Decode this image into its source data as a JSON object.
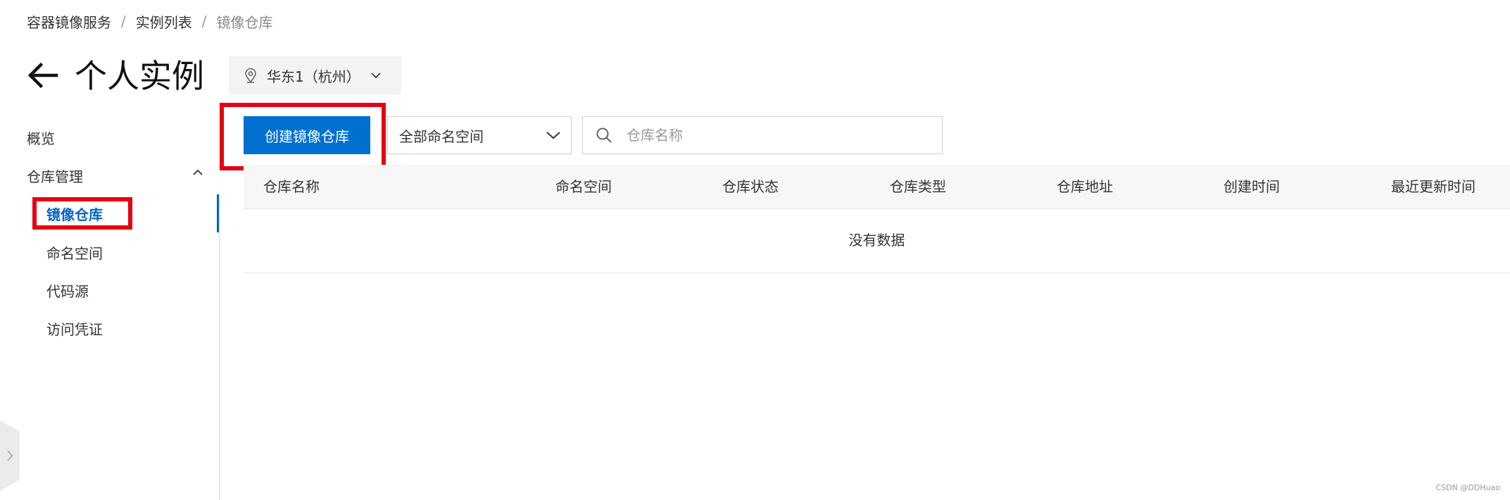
{
  "breadcrumb": {
    "items": [
      "容器镜像服务",
      "实例列表",
      "镜像仓库"
    ],
    "separator": "/"
  },
  "header": {
    "title": "个人实例",
    "region": "华东1（杭州）"
  },
  "sidebar": {
    "items": [
      {
        "label": "概览"
      },
      {
        "label": "仓库管理",
        "expanded": true
      },
      {
        "label": "镜像仓库",
        "active": true
      },
      {
        "label": "命名空间"
      },
      {
        "label": "代码源"
      },
      {
        "label": "访问凭证"
      }
    ]
  },
  "toolbar": {
    "create_label": "创建镜像仓库",
    "namespace_select": "全部命名空间",
    "search_placeholder": "仓库名称"
  },
  "table": {
    "columns": [
      "仓库名称",
      "命名空间",
      "仓库状态",
      "仓库类型",
      "仓库地址",
      "创建时间",
      "最近更新时间"
    ],
    "empty_text": "没有数据"
  },
  "watermark": "CSDN @DDHuao",
  "colors": {
    "accent": "#0070d0",
    "highlight": "#e60012",
    "header_bg": "#f7f7f7"
  }
}
